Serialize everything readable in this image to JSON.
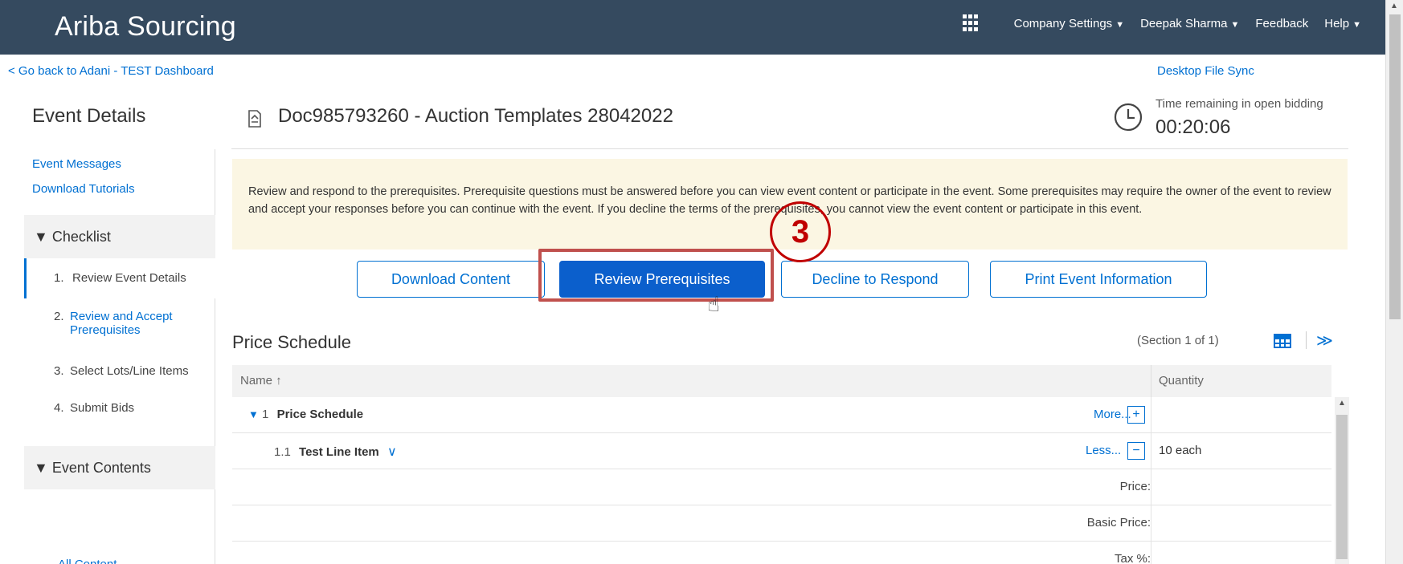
{
  "header": {
    "app_title": "Ariba Sourcing",
    "company_settings": "Company Settings",
    "user": "Deepak Sharma",
    "feedback": "Feedback",
    "help": "Help",
    "caret": "▼"
  },
  "subheader": {
    "back_link": "< Go back to Adani - TEST Dashboard",
    "desktop_sync": "Desktop File Sync"
  },
  "page": {
    "section_title": "Event Details",
    "doc_title": "Doc985793260 - Auction Templates 28042022",
    "time_label": "Time remaining in open bidding",
    "time_value": "00:20:06"
  },
  "sidebar": {
    "event_messages": "Event Messages",
    "download_tutorials": "Download Tutorials",
    "checklist": "▼ Checklist",
    "steps": [
      {
        "num": "1.",
        "label": "Review Event Details"
      },
      {
        "num": "2.",
        "label": "Review and Accept Prerequisites"
      },
      {
        "num": "3.",
        "label": "Select Lots/Line Items"
      },
      {
        "num": "4.",
        "label": "Submit Bids"
      }
    ],
    "event_contents": "▼ Event Contents",
    "all_content": "All Content"
  },
  "info": {
    "text": "Review and respond to the prerequisites. Prerequisite questions must be answered before you can view event content or participate in the event. Some prerequisites may require the owner of the event to review and accept your responses before you can continue with the event. If you decline the terms of the prerequisites, you cannot view the event content or participate in this event."
  },
  "buttons": {
    "download_content": "Download Content",
    "review_prerequisites": "Review Prerequisites",
    "decline": "Decline to Respond",
    "print": "Print Event Information"
  },
  "annotation": {
    "step_number": "3"
  },
  "price_schedule": {
    "title": "Price Schedule",
    "section_count": "(Section 1 of 1)",
    "columns": {
      "name": "Name ↑",
      "quantity": "Quantity"
    },
    "rows": [
      {
        "num": "1",
        "label": "Price Schedule",
        "action": "More...",
        "action_symbol": "+"
      },
      {
        "num": "1.1",
        "label": "Test Line Item",
        "action": "Less...",
        "action_symbol": "−",
        "quantity": "10 each"
      }
    ],
    "field_labels": [
      "Price:",
      "Basic Price:",
      "Tax %:"
    ]
  },
  "colors": {
    "header_bg": "#354a5f",
    "link": "#0070d2",
    "primary_button": "#0b5fcc",
    "info_bg": "#fbf6e3",
    "annotation_red": "#c00000"
  }
}
